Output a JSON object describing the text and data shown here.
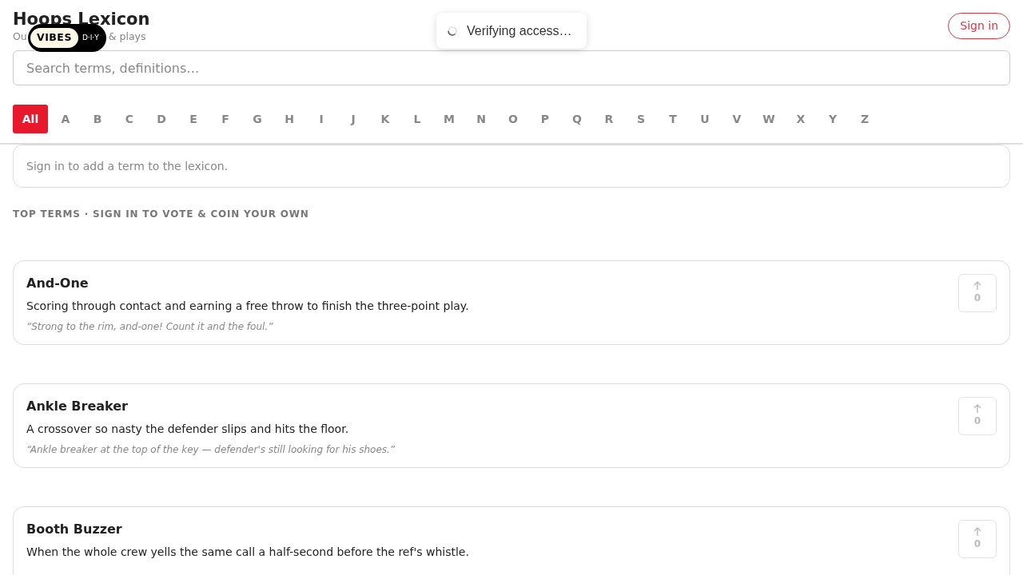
{
  "header": {
    "title": "Hoops Lexicon",
    "subtitle_parts": [
      "Ou",
      "& plays"
    ],
    "badge": {
      "left": "VIBES",
      "right": "D·I·Y"
    },
    "sign_in": "Sign in"
  },
  "toast": {
    "text": "Verifying access…"
  },
  "search": {
    "placeholder": "Search terms, definitions…"
  },
  "letters": [
    {
      "label": "All",
      "selected": true
    },
    {
      "label": "A",
      "selected": false
    },
    {
      "label": "B",
      "selected": false
    },
    {
      "label": "C",
      "selected": false
    },
    {
      "label": "D",
      "selected": false
    },
    {
      "label": "E",
      "selected": false
    },
    {
      "label": "F",
      "selected": false
    },
    {
      "label": "G",
      "selected": false
    },
    {
      "label": "H",
      "selected": false
    },
    {
      "label": "I",
      "selected": false
    },
    {
      "label": "J",
      "selected": false
    },
    {
      "label": "K",
      "selected": false
    },
    {
      "label": "L",
      "selected": false
    },
    {
      "label": "M",
      "selected": false
    },
    {
      "label": "N",
      "selected": false
    },
    {
      "label": "O",
      "selected": false
    },
    {
      "label": "P",
      "selected": false
    },
    {
      "label": "Q",
      "selected": false
    },
    {
      "label": "R",
      "selected": false
    },
    {
      "label": "S",
      "selected": false
    },
    {
      "label": "T",
      "selected": false
    },
    {
      "label": "U",
      "selected": false
    },
    {
      "label": "V",
      "selected": false
    },
    {
      "label": "W",
      "selected": false
    },
    {
      "label": "X",
      "selected": false
    },
    {
      "label": "Y",
      "selected": false
    },
    {
      "label": "Z",
      "selected": false
    }
  ],
  "notice": "Sign in to add a term to the lexicon.",
  "section_label": "TOP TERMS · SIGN IN TO VOTE & COIN YOUR OWN",
  "terms": [
    {
      "term": "And-One",
      "definition": "Scoring through contact and earning a free throw to finish the three-point play.",
      "example": "“Strong to the rim, and-one! Count it and the foul.”",
      "votes": "0"
    },
    {
      "term": "Ankle Breaker",
      "definition": "A crossover so nasty the defender slips and hits the floor.",
      "example": "“Ankle breaker at the top of the key — defender's still looking for his shoes.”",
      "votes": "0"
    },
    {
      "term": "Booth Buzzer",
      "definition": "When the whole crew yells the same call a half-second before the ref's whistle.",
      "votes": "0"
    }
  ]
}
